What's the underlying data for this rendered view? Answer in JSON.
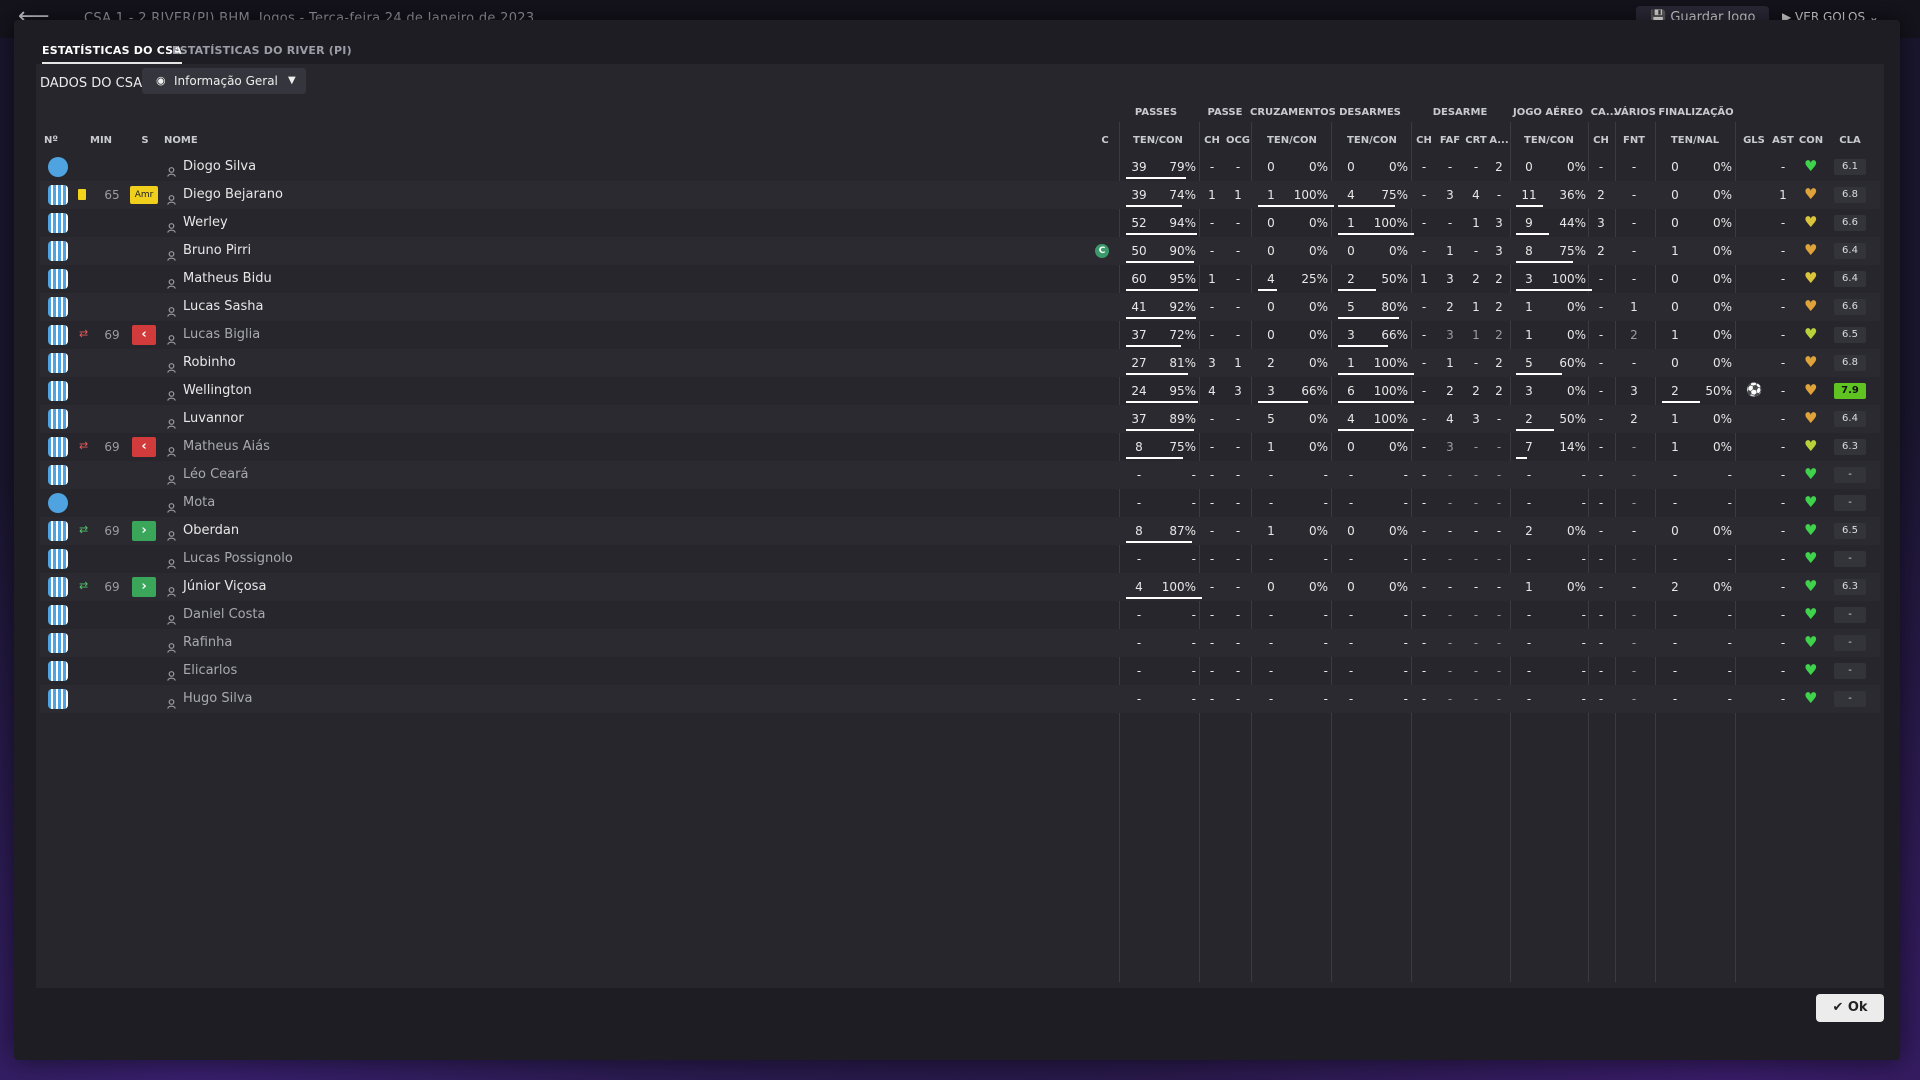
{
  "topbar": {
    "score_text": "CSA   1 - 2   RIVER(PI)   BHM, Jogos   -   Terça-feira 24 de Janeiro de 2023",
    "save_label": "Guardar Jogo",
    "goals_label": "VER GOLOS"
  },
  "tabs": [
    "ESTATÍSTICAS DO CSA",
    "ESTATÍSTICAS DO RIVER (PI)"
  ],
  "panel_title": "DADOS DO CSA",
  "dropdown_value": "Informação Geral",
  "groups": [
    "PASSES",
    "PASSE",
    "CRUZAMENTOS",
    "DESARMES",
    "DESARME",
    "JOGO AÉREO",
    "CA...",
    "VÁRIOS",
    "FINALIZAÇÃO"
  ],
  "headers": {
    "no": "Nº",
    "min": "MIN",
    "s": "S",
    "name": "NOME",
    "c": "C",
    "passes": "TEN/CON",
    "passe_ch": "CH",
    "passe_ocg": "OCG",
    "cruz": "TEN/CON",
    "desarmes": "TEN/CON",
    "des_ch": "CH",
    "des_faf": "FAF",
    "des_crt": "CRT",
    "des_a": "A...",
    "aereo": "TEN/CON",
    "ca_ch": "CH",
    "var_fnt": "FNT",
    "fin": "TEN/NAL",
    "gls": "GLS",
    "ast": "AST",
    "con": "CON",
    "cla": "CLA"
  },
  "players": [
    {
      "name": "Diogo Silva",
      "min": "",
      "badge": "",
      "sub": "",
      "captain": "",
      "p": [
        "39",
        "79%"
      ],
      "p_frac": 0.79,
      "pch": "-",
      "pocg": "-",
      "cz": [
        "0",
        "0%"
      ],
      "cz_frac": 0,
      "ds": [
        "0",
        "0%"
      ],
      "ds_frac": 0,
      "dch": "-",
      "faf": "-",
      "crt": "-",
      "da": "2",
      "ja": [
        "0",
        "0%"
      ],
      "ja_frac": 0,
      "cach": "-",
      "fnt": "-",
      "fn": [
        "0",
        "0%"
      ],
      "fn_frac": 0,
      "gls": "",
      "ast": "-",
      "con": "#3fd24b",
      "cla": "6.1",
      "gk": true,
      "dim": false
    },
    {
      "name": "Diego Bejarano",
      "min": "65",
      "badge": "Amr",
      "sub": "",
      "captain": "",
      "p": [
        "39",
        "74%"
      ],
      "p_frac": 0.74,
      "pch": "1",
      "pocg": "1",
      "cz": [
        "1",
        "100%"
      ],
      "cz_frac": 1,
      "ds": [
        "4",
        "75%"
      ],
      "ds_frac": 0.75,
      "dch": "-",
      "faf": "3",
      "crt": "4",
      "da": "-",
      "ja": [
        "11",
        "36%"
      ],
      "ja_frac": 0.36,
      "cach": "2",
      "fnt": "-",
      "fn": [
        "0",
        "0%"
      ],
      "fn_frac": 0,
      "gls": "",
      "ast": "1",
      "con": "#e0a33a",
      "cla": "6.8",
      "gk": false,
      "dim": false,
      "yellow": true
    },
    {
      "name": "Werley",
      "min": "",
      "badge": "",
      "sub": "",
      "captain": "",
      "p": [
        "52",
        "94%"
      ],
      "p_frac": 0.94,
      "pch": "-",
      "pocg": "-",
      "cz": [
        "0",
        "0%"
      ],
      "cz_frac": 0,
      "ds": [
        "1",
        "100%"
      ],
      "ds_frac": 1,
      "dch": "-",
      "faf": "-",
      "crt": "1",
      "da": "3",
      "ja": [
        "9",
        "44%"
      ],
      "ja_frac": 0.44,
      "cach": "3",
      "fnt": "-",
      "fn": [
        "0",
        "0%"
      ],
      "fn_frac": 0,
      "gls": "",
      "ast": "-",
      "con": "#d9c43a",
      "cla": "6.6",
      "gk": false,
      "dim": false
    },
    {
      "name": "Bruno Pirri",
      "min": "",
      "badge": "",
      "sub": "",
      "captain": "C",
      "p": [
        "50",
        "90%"
      ],
      "p_frac": 0.9,
      "pch": "-",
      "pocg": "-",
      "cz": [
        "0",
        "0%"
      ],
      "cz_frac": 0,
      "ds": [
        "0",
        "0%"
      ],
      "ds_frac": 0,
      "dch": "-",
      "faf": "1",
      "crt": "-",
      "da": "3",
      "ja": [
        "8",
        "75%"
      ],
      "ja_frac": 0.75,
      "cach": "2",
      "fnt": "-",
      "fn": [
        "1",
        "0%"
      ],
      "fn_frac": 0,
      "gls": "",
      "ast": "-",
      "con": "#e0a33a",
      "cla": "6.4",
      "gk": false,
      "dim": false
    },
    {
      "name": "Matheus Bidu",
      "min": "",
      "badge": "",
      "sub": "",
      "captain": "",
      "p": [
        "60",
        "95%"
      ],
      "p_frac": 0.95,
      "pch": "1",
      "pocg": "-",
      "cz": [
        "4",
        "25%"
      ],
      "cz_frac": 0.25,
      "ds": [
        "2",
        "50%"
      ],
      "ds_frac": 0.5,
      "dch": "1",
      "faf": "3",
      "crt": "2",
      "da": "2",
      "ja": [
        "3",
        "100%"
      ],
      "ja_frac": 1,
      "cach": "-",
      "fnt": "-",
      "fn": [
        "0",
        "0%"
      ],
      "fn_frac": 0,
      "gls": "",
      "ast": "-",
      "con": "#d9c43a",
      "cla": "6.4",
      "gk": false,
      "dim": false
    },
    {
      "name": "Lucas Sasha",
      "min": "",
      "badge": "",
      "sub": "",
      "captain": "",
      "p": [
        "41",
        "92%"
      ],
      "p_frac": 0.92,
      "pch": "-",
      "pocg": "-",
      "cz": [
        "0",
        "0%"
      ],
      "cz_frac": 0,
      "ds": [
        "5",
        "80%"
      ],
      "ds_frac": 0.8,
      "dch": "-",
      "faf": "2",
      "crt": "1",
      "da": "2",
      "ja": [
        "1",
        "0%"
      ],
      "ja_frac": 0,
      "cach": "-",
      "fnt": "1",
      "fn": [
        "0",
        "0%"
      ],
      "fn_frac": 0,
      "gls": "",
      "ast": "-",
      "con": "#e0a33a",
      "cla": "6.6",
      "gk": false,
      "dim": false
    },
    {
      "name": "Lucas Biglia",
      "min": "69",
      "badge": "",
      "sub": "out",
      "captain": "",
      "p": [
        "37",
        "72%"
      ],
      "p_frac": 0.72,
      "pch": "-",
      "pocg": "-",
      "cz": [
        "0",
        "0%"
      ],
      "cz_frac": 0,
      "ds": [
        "3",
        "66%"
      ],
      "ds_frac": 0.66,
      "dch": "-",
      "faf": "3",
      "crt": "1",
      "da": "2",
      "ja": [
        "1",
        "0%"
      ],
      "ja_frac": 0,
      "cach": "-",
      "fnt": "2",
      "fn": [
        "1",
        "0%"
      ],
      "fn_frac": 0,
      "gls": "",
      "ast": "-",
      "con": "#b9d23a",
      "cla": "6.5",
      "gk": false,
      "dim": true
    },
    {
      "name": "Robinho",
      "min": "",
      "badge": "",
      "sub": "",
      "captain": "",
      "p": [
        "27",
        "81%"
      ],
      "p_frac": 0.81,
      "pch": "3",
      "pocg": "1",
      "cz": [
        "2",
        "0%"
      ],
      "cz_frac": 0,
      "ds": [
        "1",
        "100%"
      ],
      "ds_frac": 1,
      "dch": "-",
      "faf": "1",
      "crt": "-",
      "da": "2",
      "ja": [
        "5",
        "60%"
      ],
      "ja_frac": 0.6,
      "cach": "-",
      "fnt": "-",
      "fn": [
        "0",
        "0%"
      ],
      "fn_frac": 0,
      "gls": "",
      "ast": "-",
      "con": "#e0a33a",
      "cla": "6.8",
      "gk": false,
      "dim": false
    },
    {
      "name": "Wellington",
      "min": "",
      "badge": "",
      "sub": "",
      "captain": "",
      "p": [
        "24",
        "95%"
      ],
      "p_frac": 0.95,
      "pch": "4",
      "pocg": "3",
      "cz": [
        "3",
        "66%"
      ],
      "cz_frac": 0.66,
      "ds": [
        "6",
        "100%"
      ],
      "ds_frac": 1,
      "dch": "-",
      "faf": "2",
      "crt": "2",
      "da": "2",
      "ja": [
        "3",
        "0%"
      ],
      "ja_frac": 0,
      "cach": "-",
      "fnt": "3",
      "fn": [
        "2",
        "50%"
      ],
      "fn_frac": 0.5,
      "gls": "⚽",
      "ast": "-",
      "con": "#e0a33a",
      "cla": "7.9",
      "gk": false,
      "dim": false,
      "top": true
    },
    {
      "name": "Luvannor",
      "min": "",
      "badge": "",
      "sub": "",
      "captain": "",
      "p": [
        "37",
        "89%"
      ],
      "p_frac": 0.89,
      "pch": "-",
      "pocg": "-",
      "cz": [
        "5",
        "0%"
      ],
      "cz_frac": 0,
      "ds": [
        "4",
        "100%"
      ],
      "ds_frac": 1,
      "dch": "-",
      "faf": "4",
      "crt": "3",
      "da": "-",
      "ja": [
        "2",
        "50%"
      ],
      "ja_frac": 0.5,
      "cach": "-",
      "fnt": "2",
      "fn": [
        "1",
        "0%"
      ],
      "fn_frac": 0,
      "gls": "",
      "ast": "-",
      "con": "#e0a33a",
      "cla": "6.4",
      "gk": false,
      "dim": false
    },
    {
      "name": "Matheus Aiás",
      "min": "69",
      "badge": "",
      "sub": "out",
      "captain": "",
      "p": [
        "8",
        "75%"
      ],
      "p_frac": 0.75,
      "pch": "-",
      "pocg": "-",
      "cz": [
        "1",
        "0%"
      ],
      "cz_frac": 0,
      "ds": [
        "0",
        "0%"
      ],
      "ds_frac": 0,
      "dch": "-",
      "faf": "3",
      "crt": "-",
      "da": "-",
      "ja": [
        "7",
        "14%"
      ],
      "ja_frac": 0.14,
      "cach": "-",
      "fnt": "-",
      "fn": [
        "1",
        "0%"
      ],
      "fn_frac": 0,
      "gls": "",
      "ast": "-",
      "con": "#b9d23a",
      "cla": "6.3",
      "gk": false,
      "dim": true
    },
    {
      "name": "Léo Ceará",
      "min": "",
      "badge": "",
      "sub": "",
      "captain": "",
      "p": [
        "-",
        "-"
      ],
      "p_frac": 0,
      "pch": "-",
      "pocg": "-",
      "cz": [
        "-",
        "-"
      ],
      "cz_frac": 0,
      "ds": [
        "-",
        "-"
      ],
      "ds_frac": 0,
      "dch": "-",
      "faf": "-",
      "crt": "-",
      "da": "-",
      "ja": [
        "-",
        "-"
      ],
      "ja_frac": 0,
      "cach": "-",
      "fnt": "-",
      "fn": [
        "-",
        "-"
      ],
      "fn_frac": 0,
      "gls": "",
      "ast": "-",
      "con": "#3fd24b",
      "cla": "-",
      "gk": false,
      "dim": true
    },
    {
      "name": "Mota",
      "min": "",
      "badge": "",
      "sub": "",
      "captain": "",
      "p": [
        "-",
        "-"
      ],
      "p_frac": 0,
      "pch": "-",
      "pocg": "-",
      "cz": [
        "-",
        "-"
      ],
      "cz_frac": 0,
      "ds": [
        "-",
        "-"
      ],
      "ds_frac": 0,
      "dch": "-",
      "faf": "-",
      "crt": "-",
      "da": "-",
      "ja": [
        "-",
        "-"
      ],
      "ja_frac": 0,
      "cach": "-",
      "fnt": "-",
      "fn": [
        "-",
        "-"
      ],
      "fn_frac": 0,
      "gls": "",
      "ast": "-",
      "con": "#3fd24b",
      "cla": "-",
      "gk": true,
      "dim": true
    },
    {
      "name": "Oberdan",
      "min": "69",
      "badge": "",
      "sub": "in",
      "captain": "",
      "p": [
        "8",
        "87%"
      ],
      "p_frac": 0.87,
      "pch": "-",
      "pocg": "-",
      "cz": [
        "1",
        "0%"
      ],
      "cz_frac": 0,
      "ds": [
        "0",
        "0%"
      ],
      "ds_frac": 0,
      "dch": "-",
      "faf": "-",
      "crt": "-",
      "da": "-",
      "ja": [
        "2",
        "0%"
      ],
      "ja_frac": 0,
      "cach": "-",
      "fnt": "-",
      "fn": [
        "0",
        "0%"
      ],
      "fn_frac": 0,
      "gls": "",
      "ast": "-",
      "con": "#3fd24b",
      "cla": "6.5",
      "gk": false,
      "dim": false
    },
    {
      "name": "Lucas Possignolo",
      "min": "",
      "badge": "",
      "sub": "",
      "captain": "",
      "p": [
        "-",
        "-"
      ],
      "p_frac": 0,
      "pch": "-",
      "pocg": "-",
      "cz": [
        "-",
        "-"
      ],
      "cz_frac": 0,
      "ds": [
        "-",
        "-"
      ],
      "ds_frac": 0,
      "dch": "-",
      "faf": "-",
      "crt": "-",
      "da": "-",
      "ja": [
        "-",
        "-"
      ],
      "ja_frac": 0,
      "cach": "-",
      "fnt": "-",
      "fn": [
        "-",
        "-"
      ],
      "fn_frac": 0,
      "gls": "",
      "ast": "-",
      "con": "#3fd24b",
      "cla": "-",
      "gk": false,
      "dim": true
    },
    {
      "name": "Júnior Viçosa",
      "min": "69",
      "badge": "",
      "sub": "in",
      "captain": "",
      "p": [
        "4",
        "100%"
      ],
      "p_frac": 1,
      "pch": "-",
      "pocg": "-",
      "cz": [
        "0",
        "0%"
      ],
      "cz_frac": 0,
      "ds": [
        "0",
        "0%"
      ],
      "ds_frac": 0,
      "dch": "-",
      "faf": "-",
      "crt": "-",
      "da": "-",
      "ja": [
        "1",
        "0%"
      ],
      "ja_frac": 0,
      "cach": "-",
      "fnt": "-",
      "fn": [
        "2",
        "0%"
      ],
      "fn_frac": 0,
      "gls": "",
      "ast": "-",
      "con": "#3fd24b",
      "cla": "6.3",
      "gk": false,
      "dim": false
    },
    {
      "name": "Daniel Costa",
      "min": "",
      "badge": "",
      "sub": "",
      "captain": "",
      "p": [
        "-",
        "-"
      ],
      "p_frac": 0,
      "pch": "-",
      "pocg": "-",
      "cz": [
        "-",
        "-"
      ],
      "cz_frac": 0,
      "ds": [
        "-",
        "-"
      ],
      "ds_frac": 0,
      "dch": "-",
      "faf": "-",
      "crt": "-",
      "da": "-",
      "ja": [
        "-",
        "-"
      ],
      "ja_frac": 0,
      "cach": "-",
      "fnt": "-",
      "fn": [
        "-",
        "-"
      ],
      "fn_frac": 0,
      "gls": "",
      "ast": "-",
      "con": "#3fd24b",
      "cla": "-",
      "gk": false,
      "dim": true
    },
    {
      "name": "Rafinha",
      "min": "",
      "badge": "",
      "sub": "",
      "captain": "",
      "p": [
        "-",
        "-"
      ],
      "p_frac": 0,
      "pch": "-",
      "pocg": "-",
      "cz": [
        "-",
        "-"
      ],
      "cz_frac": 0,
      "ds": [
        "-",
        "-"
      ],
      "ds_frac": 0,
      "dch": "-",
      "faf": "-",
      "crt": "-",
      "da": "-",
      "ja": [
        "-",
        "-"
      ],
      "ja_frac": 0,
      "cach": "-",
      "fnt": "-",
      "fn": [
        "-",
        "-"
      ],
      "fn_frac": 0,
      "gls": "",
      "ast": "-",
      "con": "#3fd24b",
      "cla": "-",
      "gk": false,
      "dim": true
    },
    {
      "name": "Elicarlos",
      "min": "",
      "badge": "",
      "sub": "",
      "captain": "",
      "p": [
        "-",
        "-"
      ],
      "p_frac": 0,
      "pch": "-",
      "pocg": "-",
      "cz": [
        "-",
        "-"
      ],
      "cz_frac": 0,
      "ds": [
        "-",
        "-"
      ],
      "ds_frac": 0,
      "dch": "-",
      "faf": "-",
      "crt": "-",
      "da": "-",
      "ja": [
        "-",
        "-"
      ],
      "ja_frac": 0,
      "cach": "-",
      "fnt": "-",
      "fn": [
        "-",
        "-"
      ],
      "fn_frac": 0,
      "gls": "",
      "ast": "-",
      "con": "#3fd24b",
      "cla": "-",
      "gk": false,
      "dim": true
    },
    {
      "name": "Hugo Silva",
      "min": "",
      "badge": "",
      "sub": "",
      "captain": "",
      "p": [
        "-",
        "-"
      ],
      "p_frac": 0,
      "pch": "-",
      "pocg": "-",
      "cz": [
        "-",
        "-"
      ],
      "cz_frac": 0,
      "ds": [
        "-",
        "-"
      ],
      "ds_frac": 0,
      "dch": "-",
      "faf": "-",
      "crt": "-",
      "da": "-",
      "ja": [
        "-",
        "-"
      ],
      "ja_frac": 0,
      "cach": "-",
      "fnt": "-",
      "fn": [
        "-",
        "-"
      ],
      "fn_frac": 0,
      "gls": "",
      "ast": "-",
      "con": "#3fd24b",
      "cla": "-",
      "gk": false,
      "dim": true
    }
  ],
  "ok_label": "Ok"
}
